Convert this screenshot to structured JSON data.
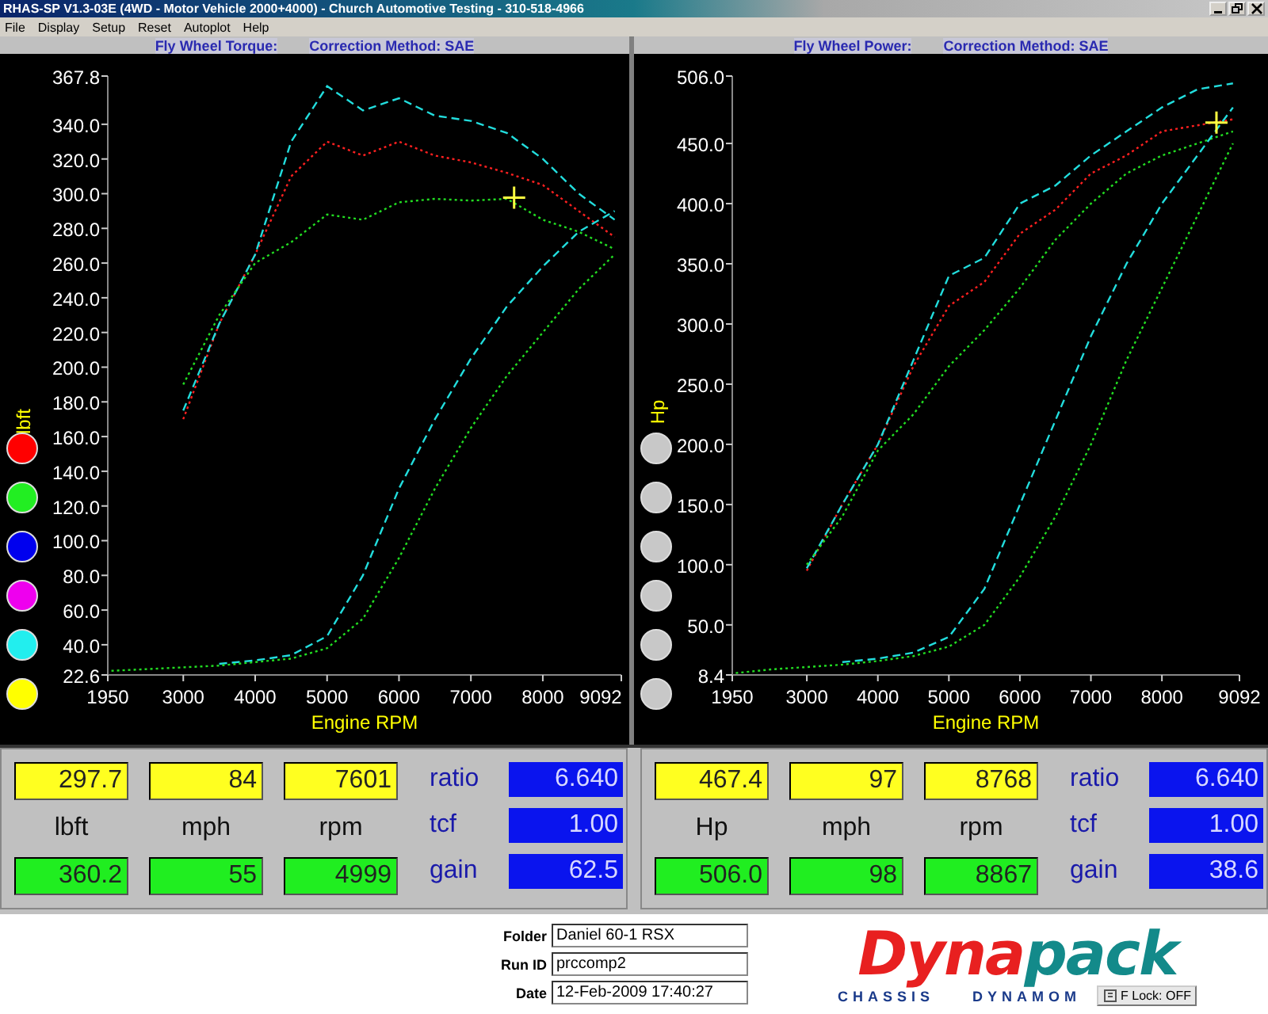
{
  "window": {
    "title": "RHAS-SP V1.3-03E (4WD - Motor Vehicle 2000+4000) - Church Automotive Testing - 310-518-4966"
  },
  "menu": [
    "File",
    "Display",
    "Setup",
    "Reset",
    "Autoplot",
    "Help"
  ],
  "panels": [
    {
      "heading": "Fly Wheel Torque:",
      "correction": "Correction Method: SAE",
      "legend_dots": [
        {
          "color": "#ff0000"
        },
        {
          "color": "#22ee22"
        },
        {
          "color": "#0000ee"
        },
        {
          "color": "#ee00ee"
        },
        {
          "color": "#22eeee"
        },
        {
          "color": "#ffff00"
        }
      ],
      "chart_data": {
        "type": "line",
        "xlabel": "Engine RPM",
        "ylabel": "lbft",
        "xlim": [
          1950,
          9092
        ],
        "ylim": [
          22.6,
          367.8
        ],
        "xticks": [
          1950,
          3000,
          4000,
          5000,
          6000,
          7000,
          8000,
          9092
        ],
        "yticks": [
          {
            "value": 22.6,
            "label": "22.6"
          },
          {
            "value": 40,
            "label": "40.0"
          },
          {
            "value": 60,
            "label": "60.0"
          },
          {
            "value": 80,
            "label": "80.0"
          },
          {
            "value": 100,
            "label": "100.0"
          },
          {
            "value": 120,
            "label": "120.0"
          },
          {
            "value": 140,
            "label": "140.0"
          },
          {
            "value": 160,
            "label": "160.0"
          },
          {
            "value": 180,
            "label": "180.0"
          },
          {
            "value": 200,
            "label": "200.0"
          },
          {
            "value": 220,
            "label": "220.0"
          },
          {
            "value": 240,
            "label": "240.0"
          },
          {
            "value": 260,
            "label": "260.0"
          },
          {
            "value": 280,
            "label": "280.0"
          },
          {
            "value": 300,
            "label": "300.0"
          },
          {
            "value": 320,
            "label": "320.0"
          },
          {
            "value": 340,
            "label": "340.0"
          },
          {
            "value": 367.8,
            "label": "367.8"
          }
        ],
        "x": [
          2000,
          2500,
          3000,
          3500,
          4000,
          4500,
          5000,
          5500,
          6000,
          6500,
          7000,
          7500,
          8000,
          8500,
          9000
        ],
        "series": [
          {
            "color": "#ff2020",
            "line_style": "dotted",
            "values": [
              null,
              null,
              170,
              225,
              265,
              310,
              330,
              322,
              330,
              322,
              318,
              312,
              305,
              290,
              275
            ]
          },
          {
            "color": "#22dddd",
            "line_style": "dashed",
            "values": [
              null,
              null,
              175,
              225,
              265,
              330,
              362,
              348,
              355,
              345,
              342,
              335,
              320,
              300,
              285
            ]
          },
          {
            "color": "#22dd22",
            "line_style": "dotted",
            "values": [
              null,
              null,
              190,
              230,
              260,
              272,
              288,
              285,
              295,
              297,
              296,
              297,
              285,
              278,
              268
            ]
          },
          {
            "color": "#22dddd",
            "line_style": "dashed",
            "values": [
              null,
              null,
              null,
              29,
              31,
              34,
              45,
              80,
              130,
              170,
              205,
              235,
              258,
              278,
              290
            ]
          },
          {
            "color": "#22dd22",
            "line_style": "dotted",
            "values": [
              25,
              26,
              27,
              28,
              30,
              32,
              38,
              55,
              90,
              130,
              165,
              195,
              220,
              245,
              265
            ]
          }
        ]
      },
      "cursor_values": [
        "297.7",
        "84",
        "7601"
      ],
      "units": [
        "lbft",
        "mph",
        "rpm"
      ],
      "peak_values": [
        "360.2",
        "55",
        "4999"
      ],
      "params": [
        {
          "label": "ratio",
          "value": "6.640"
        },
        {
          "label": "tcf",
          "value": "1.00"
        },
        {
          "label": "gain",
          "value": "62.5"
        }
      ]
    },
    {
      "heading": "Fly Wheel Power:",
      "correction": "Correction Method: SAE",
      "legend_dots": [
        {
          "color": "#c8c8c8"
        },
        {
          "color": "#c8c8c8"
        },
        {
          "color": "#c8c8c8"
        },
        {
          "color": "#c8c8c8"
        },
        {
          "color": "#c8c8c8"
        },
        {
          "color": "#c8c8c8"
        }
      ],
      "chart_data": {
        "type": "line",
        "xlabel": "Engine RPM",
        "ylabel": "Hp",
        "xlim": [
          1950,
          9092
        ],
        "ylim": [
          8.4,
          506.0
        ],
        "xticks": [
          1950,
          3000,
          4000,
          5000,
          6000,
          7000,
          8000,
          9092
        ],
        "yticks": [
          {
            "value": 8.4,
            "label": "8.4"
          },
          {
            "value": 50,
            "label": "50.0"
          },
          {
            "value": 100,
            "label": "100.0"
          },
          {
            "value": 150,
            "label": "150.0"
          },
          {
            "value": 200,
            "label": "200.0"
          },
          {
            "value": 250,
            "label": "250.0"
          },
          {
            "value": 300,
            "label": "300.0"
          },
          {
            "value": 350,
            "label": "350.0"
          },
          {
            "value": 400,
            "label": "400.0"
          },
          {
            "value": 450,
            "label": "450.0"
          },
          {
            "value": 506,
            "label": "506.0"
          }
        ],
        "x": [
          2000,
          2500,
          3000,
          3500,
          4000,
          4500,
          5000,
          5500,
          6000,
          6500,
          7000,
          7500,
          8000,
          8500,
          9000
        ],
        "series": [
          {
            "color": "#ff2020",
            "line_style": "dotted",
            "values": [
              null,
              null,
              95,
              150,
              200,
              265,
              315,
              335,
              375,
              395,
              425,
              440,
              460,
              465,
              470
            ]
          },
          {
            "color": "#22dddd",
            "line_style": "dashed",
            "values": [
              null,
              null,
              97,
              150,
              200,
              270,
              340,
              355,
              400,
              415,
              440,
              460,
              480,
              495,
              500
            ]
          },
          {
            "color": "#22dd22",
            "line_style": "dotted",
            "values": [
              null,
              null,
              100,
              140,
              195,
              225,
              265,
              295,
              330,
              370,
              400,
              425,
              440,
              450,
              460
            ]
          },
          {
            "color": "#22dddd",
            "line_style": "dashed",
            "values": [
              null,
              null,
              null,
              19,
              22,
              27,
              40,
              80,
              150,
              220,
              290,
              350,
              400,
              440,
              480
            ]
          },
          {
            "color": "#22dd22",
            "line_style": "dotted",
            "values": [
              10,
              13,
              15,
              17,
              20,
              24,
              32,
              50,
              90,
              140,
              200,
              270,
              330,
              390,
              450
            ]
          }
        ]
      },
      "cursor_values": [
        "467.4",
        "97",
        "8768"
      ],
      "units": [
        "Hp",
        "mph",
        "rpm"
      ],
      "peak_values": [
        "506.0",
        "98",
        "8867"
      ],
      "params": [
        {
          "label": "ratio",
          "value": "6.640"
        },
        {
          "label": "tcf",
          "value": "1.00"
        },
        {
          "label": "gain",
          "value": "38.6"
        }
      ]
    }
  ],
  "run_info": [
    {
      "label": "Folder",
      "value": "Daniel 60-1 RSX"
    },
    {
      "label": "Run ID",
      "value": "prccomp2"
    },
    {
      "label": "Date",
      "value": "12-Feb-2009  17:40:27"
    }
  ],
  "logo": {
    "parts": [
      "Dyna",
      "pack"
    ],
    "tagline": [
      "CHASSIS",
      "DYNAMOM"
    ]
  },
  "flock_button": "F Lock: OFF"
}
